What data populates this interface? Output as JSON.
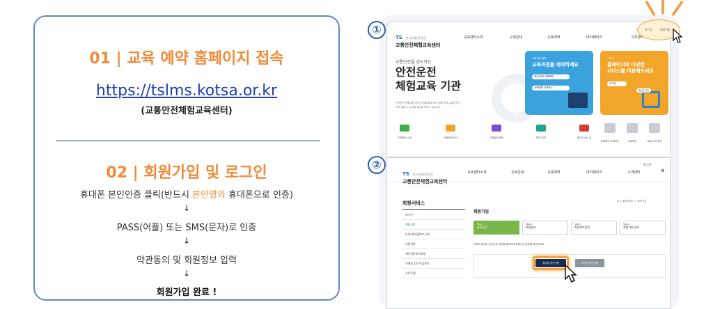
{
  "left": {
    "step1_title": "01  |  교육 예약 홈페이지 접속",
    "url": "https://tslms.kotsa.or.kr",
    "url_sub": "(교통안전체험교육센터)",
    "step2_title": "02  |  회원가입 및 로그인",
    "flow1_pre": "휴대폰 본인인증 클릭(반드시 ",
    "flow1_hl": "본인명의",
    "flow1_post": " 휴대폰으로 인증)",
    "arrow": "↓",
    "flow2": "PASS(어플) 또는 SMS(문자)로 인증",
    "flow3": "약관동의 및 회원정보 입력",
    "flow4": "회원가입 완료 !"
  },
  "shot1": {
    "num": "①",
    "logo_ts": "TS",
    "logo_small": "한국교통안전공단",
    "logo_main": "교통안전체험교육센터",
    "nav": [
      "교육센터소개",
      "교육안내",
      "교육예약",
      "마이페이지",
      "고객센터"
    ],
    "login": "로그인",
    "join": "회원가입",
    "hero_small": "교통안전을 선도하는",
    "hero_line1": "안전운전",
    "hero_line2": "체험교육 기관",
    "hero_desc1": "안전운전 체험교육 과정 운영을 통해 우리 생활 속에 교통안전이",
    "hero_desc2": "자리 잡을 수 있도록 최선을 다하고 있습니다.",
    "blue_small": "교육과정 예약",
    "blue_title": "교육과정을 예약하세요",
    "blue_btn1": "개인/학교 교육예약",
    "blue_btn2": "교육예약 교육하는 ",
    "orange_small": "포인트",
    "orange_title1": "홈페이지의 다양한",
    "orange_title2": "서비스를 이용해보세요",
    "orange_btn": "로그인",
    "orange_badge": "포인트 조회",
    "icons": [
      "교육센터 소개",
      "교육과정 안내",
      "교육일정 확인",
      "예약 확인",
      "찾아오시는 길"
    ],
    "grey_icons": [
      "교육예약 조회하기",
      "수료확인",
      "자료/자격 확인"
    ],
    "colors": {
      "green": "#3fae49",
      "orange": "#f1a52a",
      "purple": "#7b4fc9",
      "teal": "#20a58a",
      "red": "#d13b3b"
    }
  },
  "shot2": {
    "num": "②",
    "logo_ts": "TS",
    "logo_small": "한국교통안전공단",
    "logo_main": "교통안전체험교육센터",
    "nav": [
      "교육센터소개",
      "교육안내",
      "교육예약",
      "마이페이지",
      "고객센터"
    ],
    "login": "로그인",
    "side_title": "회원서비스",
    "side_items": [
      "로그인",
      "회원가입",
      "아이디/비밀번호 찾기",
      "이용약관",
      "개인정보처리방침",
      "이메일 무단수집거부",
      "사이트맵"
    ],
    "breadcrumb": "홈  >  회원서비스  >  회원가입",
    "page_title": "회원가입",
    "steps": [
      {
        "num": "Step 1",
        "label": "본인인증"
      },
      {
        "num": "Step 2",
        "label": "약관동의"
      },
      {
        "num": "Step 3",
        "label": "회원정보입력"
      },
      {
        "num": "Step 4",
        "label": "회원가입 완료"
      }
    ],
    "notice": "아래의 휴대폰 본인인증 버튼을 클릭하여 회원가입 여부를 확인하세요.",
    "btn_phone": "휴대폰 본인인증",
    "btn_ipin": "아이핀 본인인증"
  }
}
